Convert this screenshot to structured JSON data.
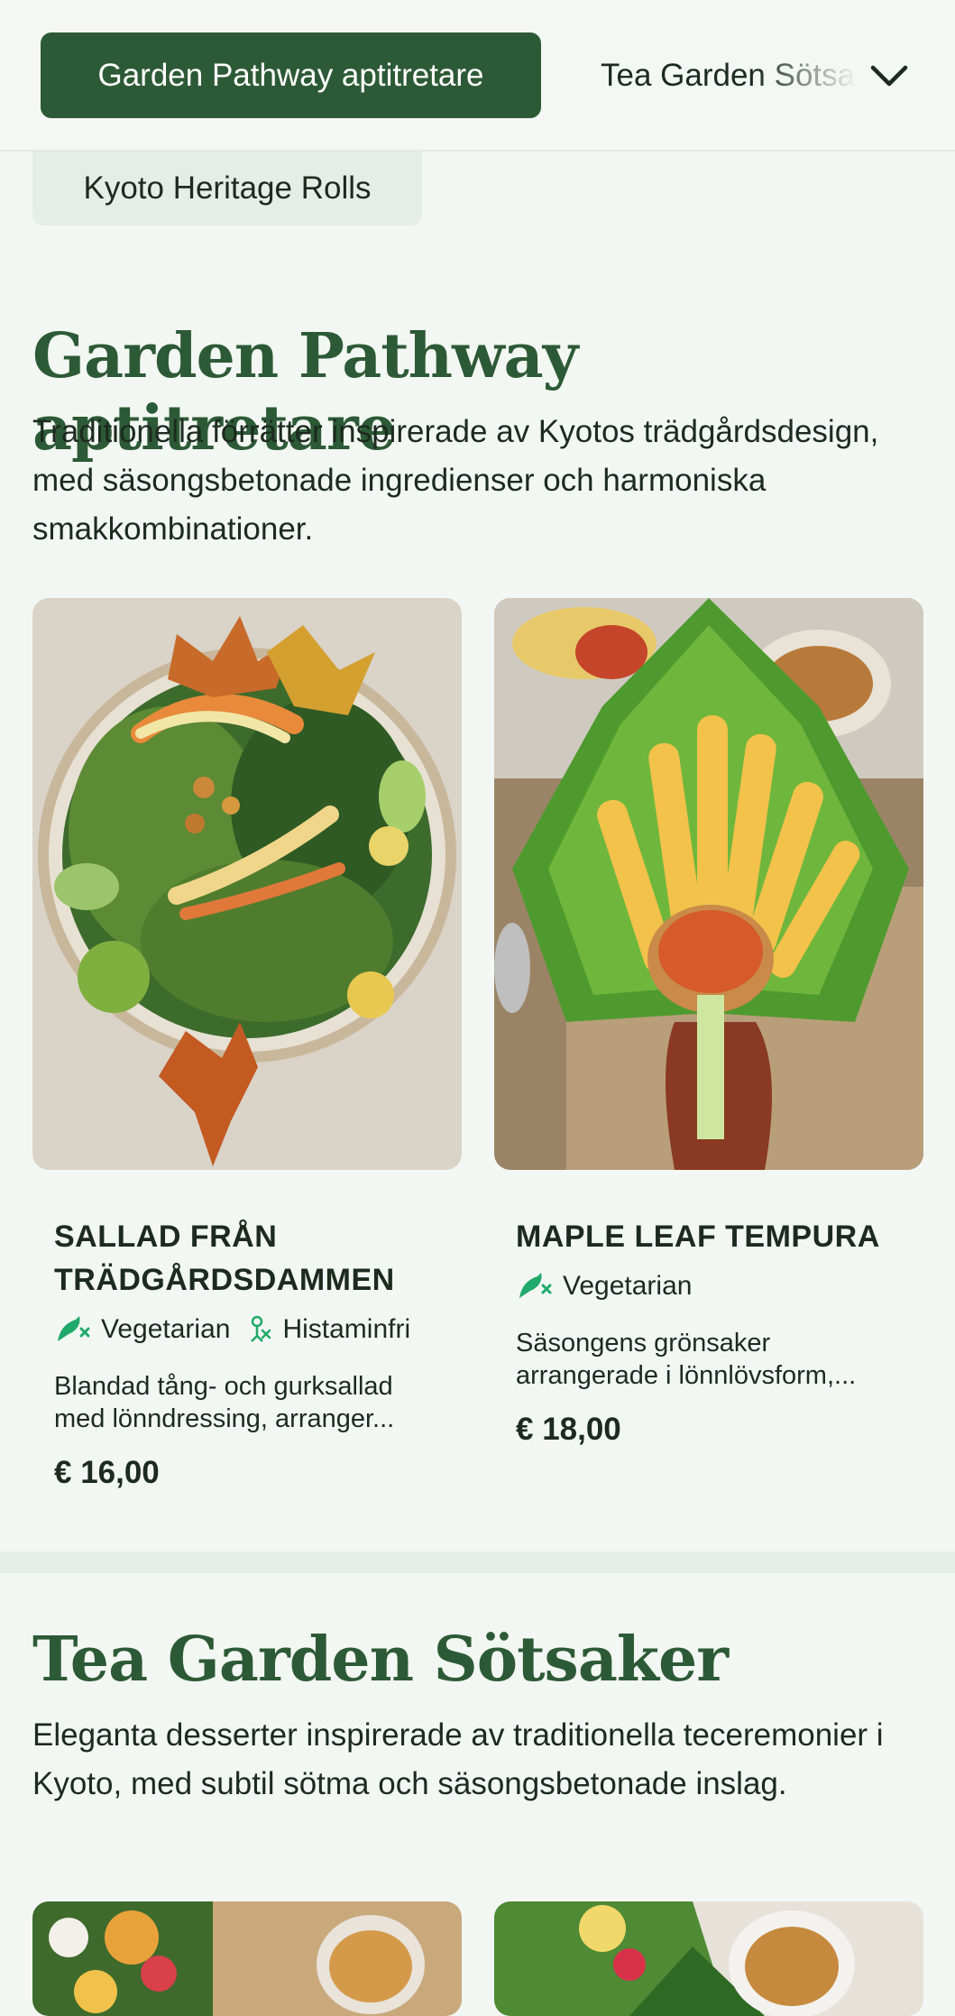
{
  "nav": {
    "active_tab": "Garden Pathway aptitretare",
    "next_tab": "Tea Garden Sötsaker",
    "sub_tab": "Kyoto Heritage Rolls"
  },
  "sections": [
    {
      "title": "Garden Pathway aptitretare",
      "description": "Traditionella förrätter inspirerade av Kyotos trädgårdsdesign, med säsongsbetonade ingredienser och harmoniska smakkombinationer.",
      "items": [
        {
          "name": "Sallad från trädgårdsdammen",
          "tags": [
            "Vegetarian",
            "Histaminfri"
          ],
          "description": "Blandad tång- och gurksallad med lönndressing, arranger...",
          "price": "€ 16,00"
        },
        {
          "name": "Maple Leaf Tempura",
          "tags": [
            "Vegetarian"
          ],
          "description": "Säsongens grönsaker arrangerade i lönnlövsform,...",
          "price": "€ 18,00"
        }
      ]
    },
    {
      "title": "Tea Garden Sötsaker",
      "description": "Eleganta desserter inspirerade av traditionella teceremonier i Kyoto, med subtil sötma och säsongsbetonade inslag."
    }
  ],
  "icons": {
    "chevron": "chevron-down-icon",
    "vegetarian": "vegetarian-icon",
    "histamine_free": "histamine-free-icon"
  },
  "colors": {
    "brand": "#2d5a36",
    "background": "#f3f7f3",
    "tag_icon": "#1faa6b"
  }
}
